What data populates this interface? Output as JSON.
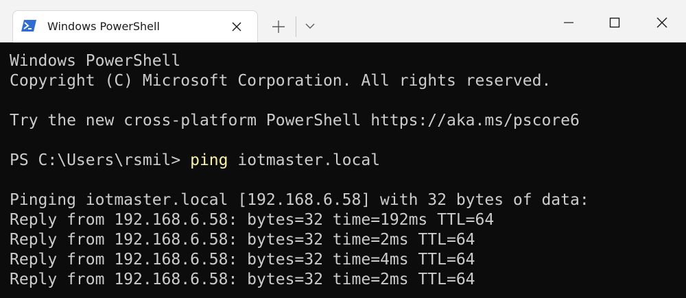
{
  "window": {
    "tab_title": "Windows PowerShell",
    "tab_icon": "powershell-icon",
    "new_tab_icon": "plus-icon",
    "dropdown_icon": "chevron-down-icon",
    "minimize_icon": "minimize-icon",
    "maximize_icon": "maximize-icon",
    "close_icon": "close-icon"
  },
  "colors": {
    "titlebar_bg": "#f3f3f3",
    "tab_bg": "#ffffff",
    "console_bg": "#0c0c0c",
    "console_text": "#cccccc",
    "command_text": "#f9f1a5",
    "powershell_icon": "#2f6ed0"
  },
  "console": {
    "header1": "Windows PowerShell",
    "header2": "Copyright (C) Microsoft Corporation. All rights reserved.",
    "try_line": "Try the new cross-platform PowerShell https://aka.ms/pscore6",
    "prompt": "PS C:\\Users\\rsmil> ",
    "command": "ping",
    "argument": " iotmaster.local",
    "pinging_line": "Pinging iotmaster.local [192.168.6.58] with 32 bytes of data:",
    "replies": [
      "Reply from 192.168.6.58: bytes=32 time=192ms TTL=64",
      "Reply from 192.168.6.58: bytes=32 time=2ms TTL=64",
      "Reply from 192.168.6.58: bytes=32 time=4ms TTL=64",
      "Reply from 192.168.6.58: bytes=32 time=2ms TTL=64"
    ]
  }
}
